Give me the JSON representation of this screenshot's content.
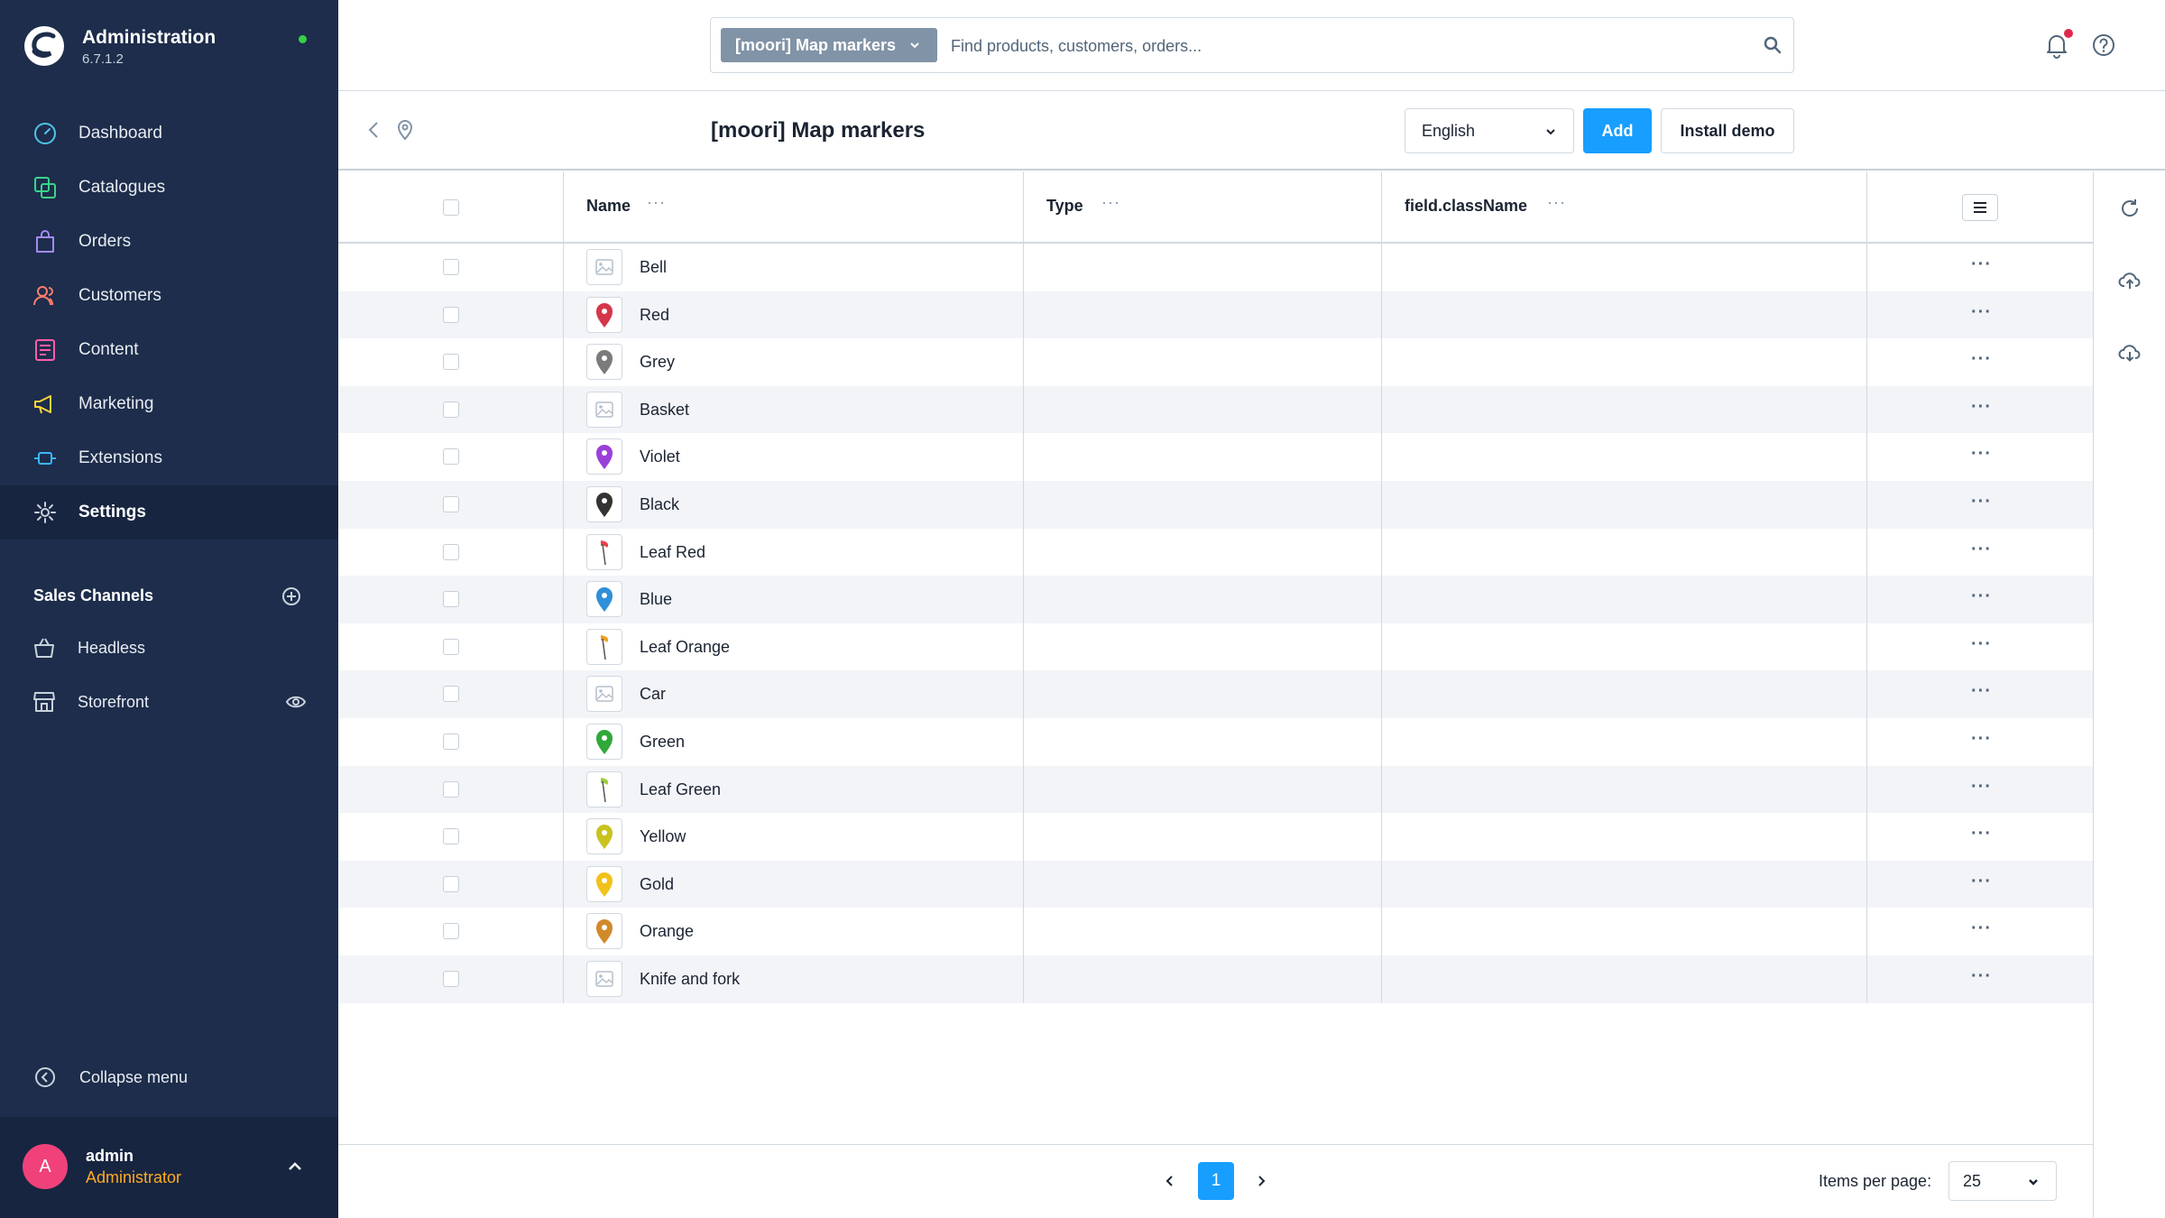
{
  "app": {
    "title": "Administration",
    "version": "6.7.1.2"
  },
  "nav": [
    {
      "label": "Dashboard",
      "icon": "dashboard-icon"
    },
    {
      "label": "Catalogues",
      "icon": "catalogues-icon"
    },
    {
      "label": "Orders",
      "icon": "orders-icon"
    },
    {
      "label": "Customers",
      "icon": "customers-icon"
    },
    {
      "label": "Content",
      "icon": "content-icon"
    },
    {
      "label": "Marketing",
      "icon": "marketing-icon"
    },
    {
      "label": "Extensions",
      "icon": "extensions-icon"
    },
    {
      "label": "Settings",
      "icon": "gear-icon",
      "active": true
    }
  ],
  "sales_channels": {
    "title": "Sales Channels",
    "items": [
      {
        "label": "Headless",
        "icon": "basket-icon"
      },
      {
        "label": "Storefront",
        "icon": "storefront-icon"
      }
    ]
  },
  "collapse_label": "Collapse menu",
  "user": {
    "initial": "A",
    "name": "admin",
    "role": "Administrator"
  },
  "search": {
    "type_label": "[moori] Map markers",
    "placeholder": "Find products, customers, orders..."
  },
  "page": {
    "title": "[moori] Map markers",
    "language": "English",
    "add_label": "Add",
    "install_demo_label": "Install demo"
  },
  "grid": {
    "columns": [
      {
        "label": "Name"
      },
      {
        "label": "Type"
      },
      {
        "label": "field.className"
      }
    ],
    "rows": [
      {
        "name": "Bell",
        "marker": "placeholder",
        "color": ""
      },
      {
        "name": "Red",
        "marker": "pin",
        "color": "#d5374a"
      },
      {
        "name": "Grey",
        "marker": "pin",
        "color": "#7b7b7b"
      },
      {
        "name": "Basket",
        "marker": "placeholder",
        "color": ""
      },
      {
        "name": "Violet",
        "marker": "pin",
        "color": "#9b3fd9"
      },
      {
        "name": "Black",
        "marker": "pin",
        "color": "#333333"
      },
      {
        "name": "Leaf Red",
        "marker": "leaf",
        "color": "#e8424f"
      },
      {
        "name": "Blue",
        "marker": "pin",
        "color": "#2f8fd8"
      },
      {
        "name": "Leaf Orange",
        "marker": "leaf",
        "color": "#f0a020"
      },
      {
        "name": "Car",
        "marker": "placeholder",
        "color": ""
      },
      {
        "name": "Green",
        "marker": "pin",
        "color": "#31a83a"
      },
      {
        "name": "Leaf Green",
        "marker": "leaf",
        "color": "#9fcb3a"
      },
      {
        "name": "Yellow",
        "marker": "pin",
        "color": "#c9c21f"
      },
      {
        "name": "Gold",
        "marker": "pin",
        "color": "#f1c21b"
      },
      {
        "name": "Orange",
        "marker": "pin",
        "color": "#d08a2a"
      },
      {
        "name": "Knife and fork",
        "marker": "placeholder",
        "color": ""
      }
    ]
  },
  "pagination": {
    "current_page": "1",
    "items_per_page_label": "Items per page:",
    "items_per_page": "25"
  },
  "colors": {
    "sidebar": "#1d2d4b",
    "accent": "#189eff",
    "status_online": "#37d046",
    "avatar": "#f0417b",
    "role": "#ffab22"
  }
}
